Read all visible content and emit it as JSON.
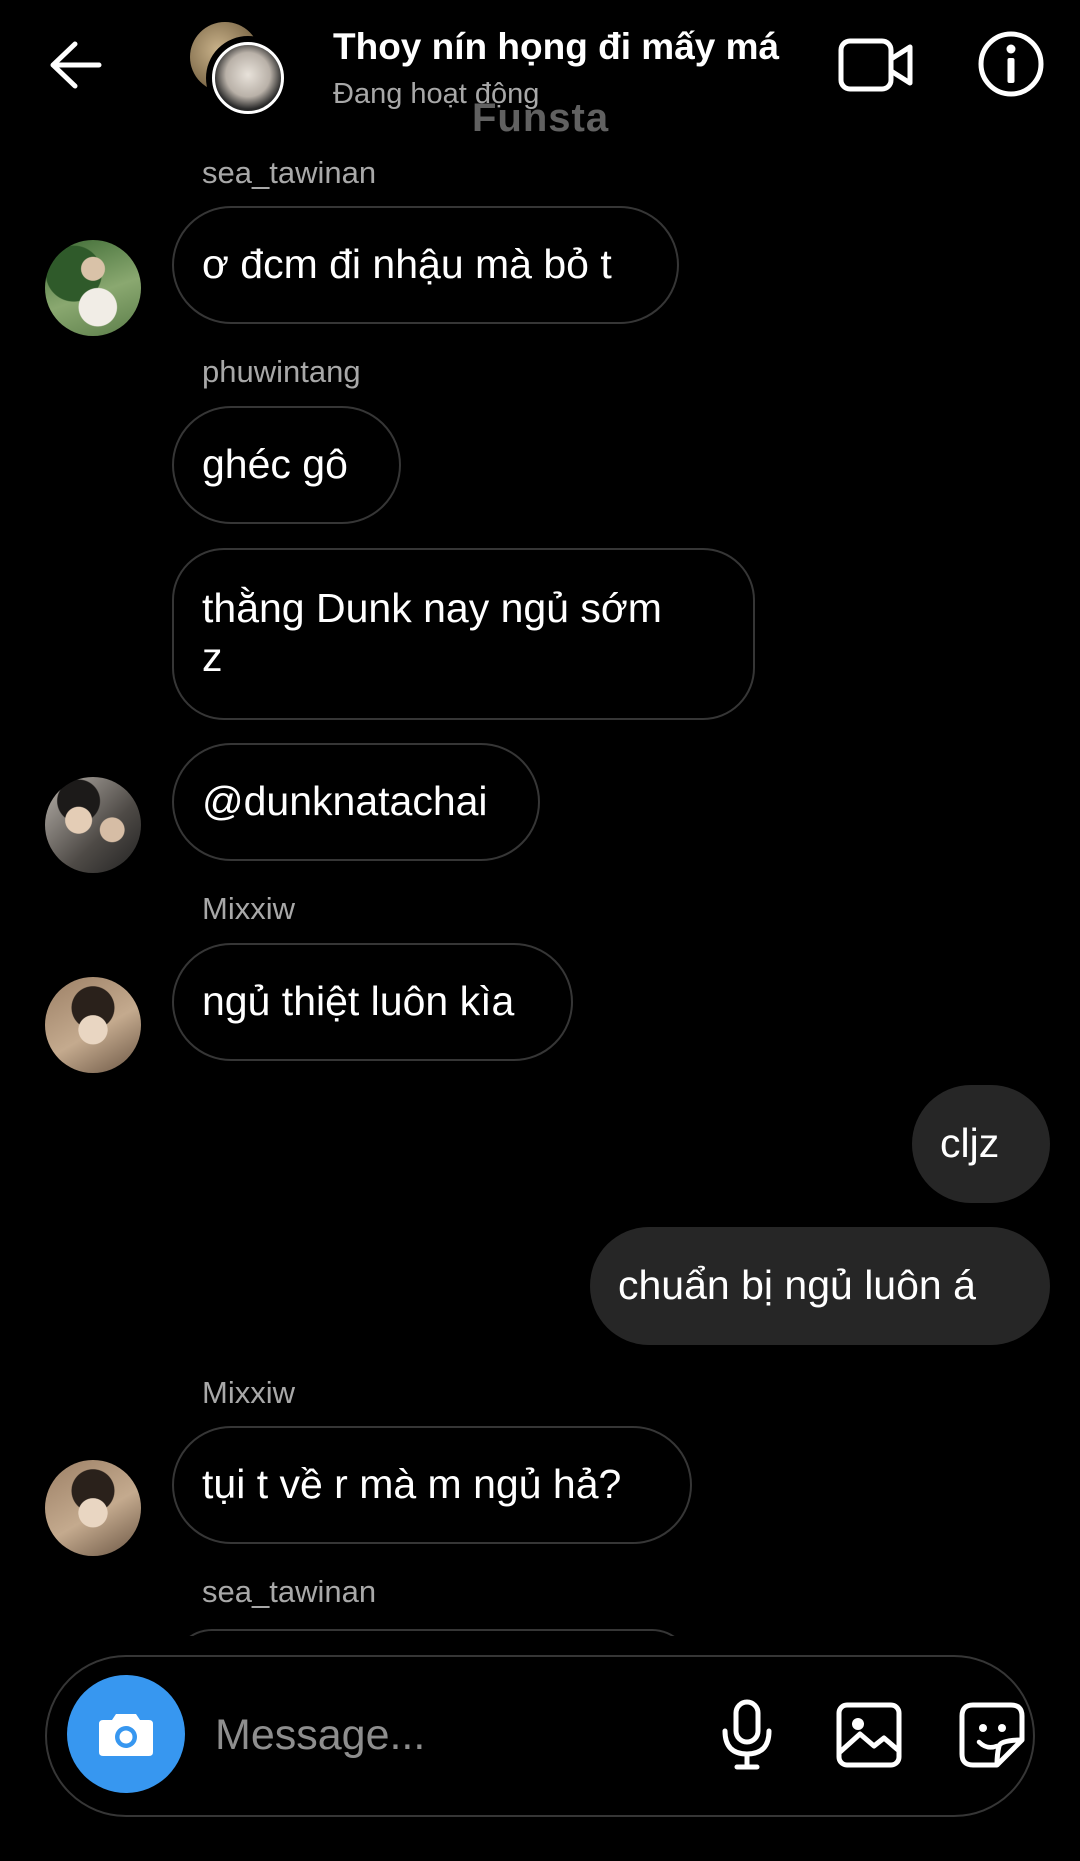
{
  "header": {
    "title": "Thoy nín họng đi mấy má",
    "status": "Đang hoạt động",
    "watermark": "Funsta",
    "icons": {
      "back": "arrow-left-icon",
      "video": "video-call-icon",
      "info": "info-icon"
    }
  },
  "messages": {
    "m1": {
      "sender": "sea_tawinan",
      "text": "ơ đcm đi nhậu mà bỏ t"
    },
    "m2": {
      "sender": "phuwintang",
      "text": "ghéc gô"
    },
    "m3": {
      "text": "thằng Dunk nay ngủ sớm z"
    },
    "m4": {
      "text": "@dunknatachai"
    },
    "m5": {
      "sender": "Mixxiw",
      "text": "ngủ thiệt luôn kìa"
    },
    "m6": {
      "text": "cljz"
    },
    "m7": {
      "text": "chuẩn bị ngủ luôn á"
    },
    "m8": {
      "sender": "Mixxiw",
      "text": "tụi t về r mà m ngủ hả?"
    },
    "m9": {
      "sender": "sea_tawinan"
    }
  },
  "composer": {
    "placeholder": "Message...",
    "icons": {
      "camera": "camera-icon",
      "mic": "microphone-icon",
      "gallery": "gallery-icon",
      "sticker": "sticker-icon"
    }
  },
  "colors": {
    "background": "#000000",
    "bubble_border": "#363636",
    "own_bubble": "#262626",
    "camera_button": "#3797f0",
    "secondary_text": "#a8a8a8"
  }
}
